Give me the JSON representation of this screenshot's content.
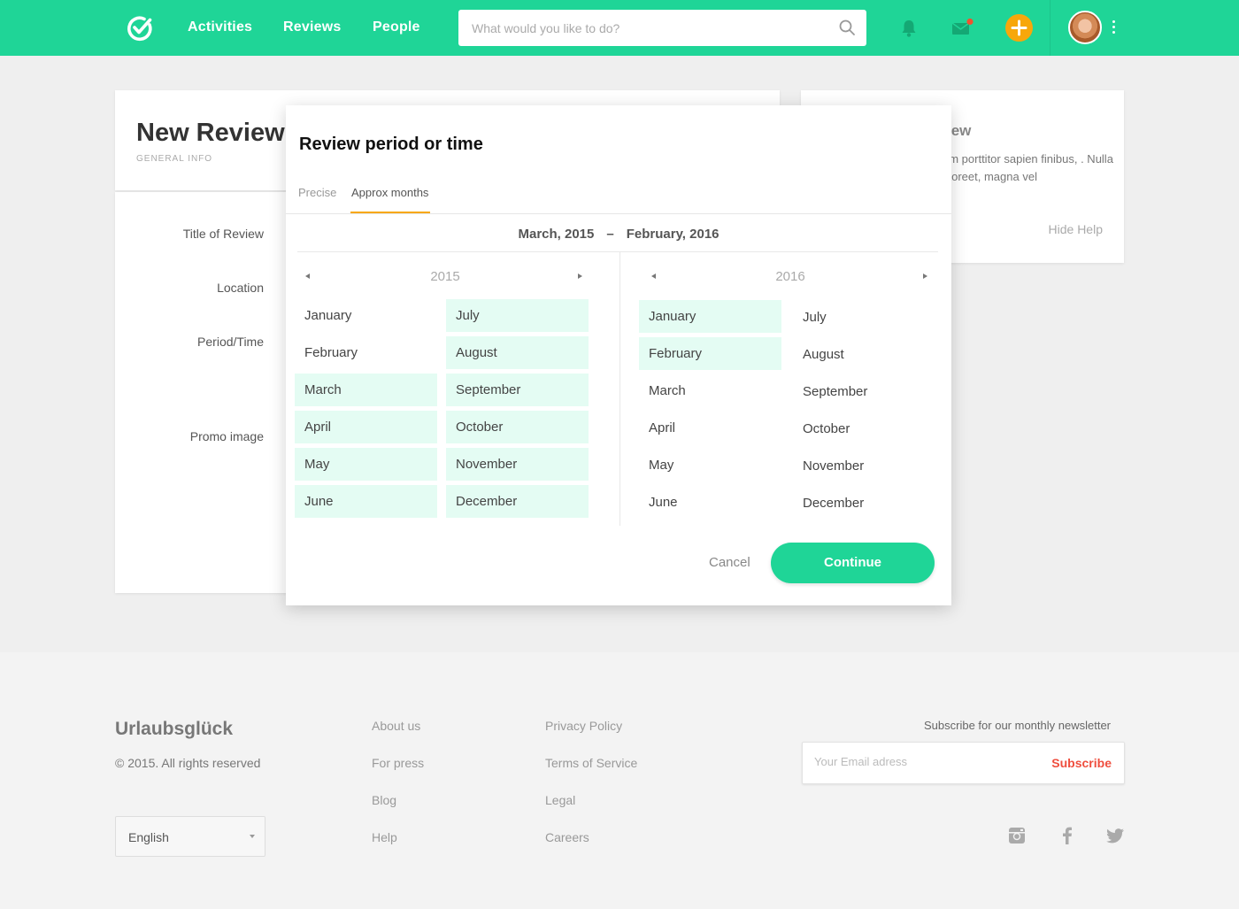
{
  "nav": {
    "links": [
      "Activities",
      "Reviews",
      "People"
    ],
    "search_placeholder": "What would you like to do?",
    "accent": "#1fd597",
    "add_color": "#f7a70b",
    "icons": [
      "logo-check-icon",
      "search-icon",
      "bell-icon",
      "mail-icon",
      "plus-icon",
      "avatar",
      "more-vertical-icon"
    ]
  },
  "page": {
    "title": "New Review",
    "subtitle": "GENERAL INFO",
    "fields": [
      "Title of Review",
      "Location",
      "Period/Time",
      "Promo image"
    ],
    "help_title_fragment": "iew",
    "help_text": "um porttitor sapien finibus, . Nulla laoreet, magna vel",
    "hide_help": "Hide Help"
  },
  "modal": {
    "title": "Review period or time",
    "tabs": [
      {
        "label": "Precise",
        "active": false
      },
      {
        "label": "Approx months",
        "active": true
      }
    ],
    "range_start": "March, 2015",
    "range_sep": "–",
    "range_end": "February, 2016",
    "years": [
      {
        "year": "2015",
        "months_col1": [
          {
            "label": "January",
            "selected": false
          },
          {
            "label": "February",
            "selected": false
          },
          {
            "label": "March",
            "selected": true
          },
          {
            "label": "April",
            "selected": true
          },
          {
            "label": "May",
            "selected": true
          },
          {
            "label": "June",
            "selected": true
          }
        ],
        "months_col2": [
          {
            "label": "July",
            "selected": true
          },
          {
            "label": "August",
            "selected": true
          },
          {
            "label": "September",
            "selected": true
          },
          {
            "label": "October",
            "selected": true
          },
          {
            "label": "November",
            "selected": true
          },
          {
            "label": "December",
            "selected": true
          }
        ]
      },
      {
        "year": "2016",
        "months_col1": [
          {
            "label": "January",
            "selected": true
          },
          {
            "label": "February",
            "selected": true
          },
          {
            "label": "March",
            "selected": false
          },
          {
            "label": "April",
            "selected": false
          },
          {
            "label": "May",
            "selected": false
          },
          {
            "label": "June",
            "selected": false
          }
        ],
        "months_col2": [
          {
            "label": "July",
            "selected": false
          },
          {
            "label": "August",
            "selected": false
          },
          {
            "label": "September",
            "selected": false
          },
          {
            "label": "October",
            "selected": false
          },
          {
            "label": "November",
            "selected": false
          },
          {
            "label": "December",
            "selected": false
          }
        ]
      }
    ],
    "cancel": "Cancel",
    "continue": "Continue",
    "selected_bg": "#e4fcf3"
  },
  "footer": {
    "brand": "Urlaubsglück",
    "copyright": "© 2015. All rights reserved",
    "col1": [
      "About us",
      "For press",
      "Blog",
      "Help"
    ],
    "col2": [
      "Privacy Policy",
      "Terms of Service",
      "Legal",
      "Careers"
    ],
    "language": "English",
    "subscribe_label": "Subscribe for our monthly newsletter",
    "email_placeholder": "Your Email adress",
    "subscribe_button": "Subscribe",
    "social_icons": [
      "instagram-icon",
      "facebook-icon",
      "twitter-icon"
    ]
  }
}
